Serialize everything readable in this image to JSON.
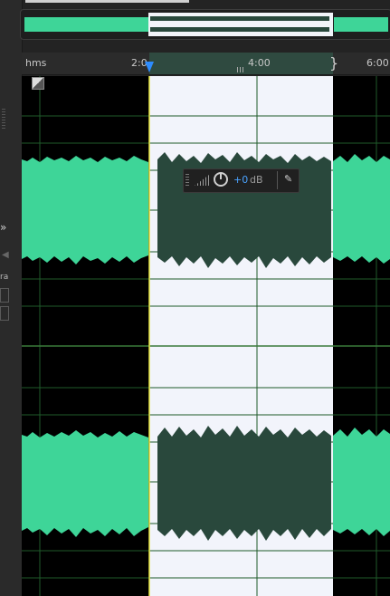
{
  "ruler": {
    "unit": "hms",
    "tick_start": "2:0",
    "tick_mid": "4:00",
    "tick_end": "6:00"
  },
  "hud": {
    "value": "+0",
    "unit": "dB"
  },
  "left_panel": {
    "label_ra": "ra"
  },
  "colors": {
    "waveform": "#3ed598",
    "waveform_selected": "#29483c",
    "selection_bg": "#f2f4fb",
    "playhead": "#2d8cff"
  }
}
